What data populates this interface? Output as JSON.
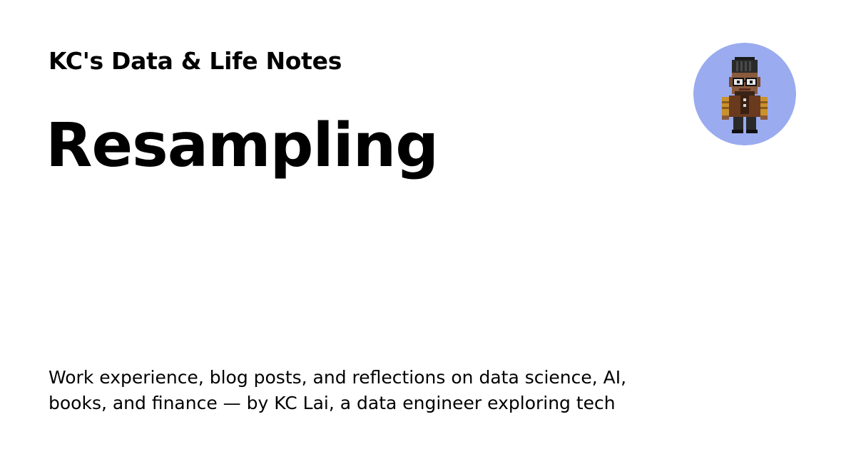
{
  "site": {
    "name": "KC's Data & Life Notes"
  },
  "post": {
    "title": "Resampling"
  },
  "description": {
    "line1": "Work experience, blog posts, and reflections on data science, AI,",
    "line2": "books, and finance — by KC Lai, a data engineer exploring tech"
  },
  "avatar": {
    "icon": "pixel-art-person-avatar-icon",
    "background_color": "#9aabef"
  }
}
